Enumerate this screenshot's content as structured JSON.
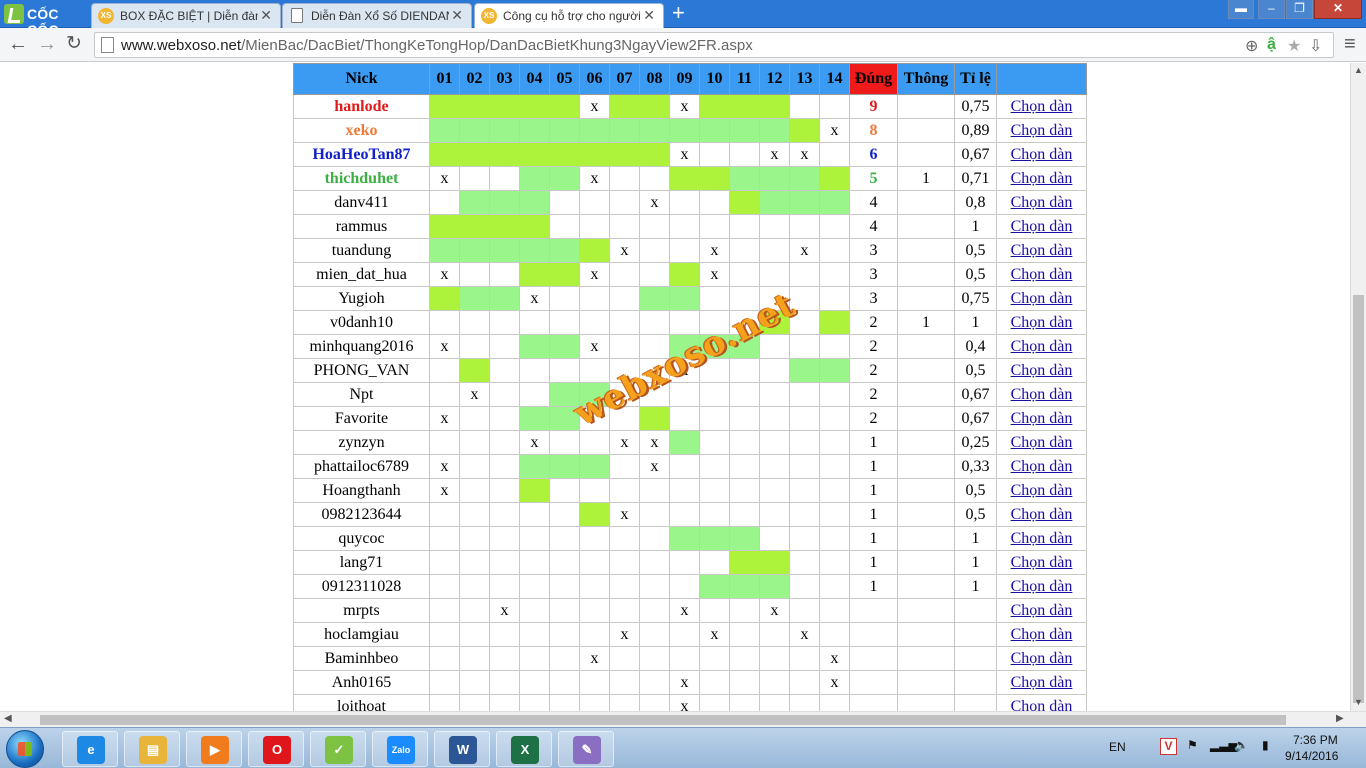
{
  "browser": {
    "brand": "CỐC CỐC",
    "tabs": [
      {
        "title": "BOX ĐẶC BIỆT | Diễn đàn xổ số",
        "icon": "xs-favicon",
        "active": false
      },
      {
        "title": "Diễn Đàn Xổ Số DIENDANXOSO",
        "icon": "page-icon",
        "active": false
      },
      {
        "title": "Công cụ hỗ trợ cho người chơi",
        "icon": "xs-favicon",
        "active": true
      }
    ],
    "favicon_label": "XS",
    "url_domain": "www.webxoso.net",
    "url_path": "/MienBac/DacBiet/ThongKeTongHop/DanDacBietKhung3NgayView2FR.aspx"
  },
  "table": {
    "headers": {
      "nick": "Nick",
      "cols": [
        "01",
        "02",
        "03",
        "04",
        "05",
        "06",
        "07",
        "08",
        "09",
        "10",
        "11",
        "12",
        "13",
        "14"
      ],
      "dung": "Đúng",
      "thong": "Thông",
      "tile": "Tỉ lệ"
    },
    "link_label": "Chọn dàn",
    "rows": [
      {
        "nick": "hanlode",
        "color": "#e01b1b",
        "bold": true,
        "cells": "gggggxggxggg__",
        "dung": "9",
        "thong": "",
        "tile": "0,75"
      },
      {
        "nick": "xeko",
        "color": "#f07a3c",
        "bold": true,
        "cells": "hhhhhhhhhhhhgx",
        "dung": "8",
        "thong": "",
        "tile": "0,89"
      },
      {
        "nick": "HoaHeoTan87",
        "color": "#1020c8",
        "bold": true,
        "cells": "ggggggggx__xx_",
        "dung": "6",
        "thong": "",
        "tile": "0,67"
      },
      {
        "nick": "thichduhet",
        "color": "#3cb043",
        "bold": true,
        "cells": "x__hhx__gghhhg",
        "dung": "5",
        "thong": "1",
        "tile": "0,71"
      },
      {
        "nick": "danv411",
        "color": "#000000",
        "bold": false,
        "cells": "_hhh___x__ghhh",
        "dung": "4",
        "thong": "",
        "tile": "0,8"
      },
      {
        "nick": "rammus",
        "color": "#000000",
        "bold": false,
        "cells": "gggg__________",
        "dung": "4",
        "thong": "",
        "tile": "1"
      },
      {
        "nick": "tuandung",
        "color": "#000000",
        "bold": false,
        "cells": "hhhhhgx__x__x_",
        "dung": "3",
        "thong": "",
        "tile": "0,5"
      },
      {
        "nick": "mien_dat_hua",
        "color": "#000000",
        "bold": false,
        "cells": "x__ggx__gx____",
        "dung": "3",
        "thong": "",
        "tile": "0,5"
      },
      {
        "nick": "Yugioh",
        "color": "#000000",
        "bold": false,
        "cells": "ghhx___hh_____",
        "dung": "3",
        "thong": "",
        "tile": "0,75"
      },
      {
        "nick": "v0danh10",
        "color": "#000000",
        "bold": false,
        "cells": "___________g_g",
        "dung": "2",
        "thong": "1",
        "tile": "1"
      },
      {
        "nick": "minhquang2016",
        "color": "#000000",
        "bold": false,
        "cells": "x__hhx__hhh___",
        "dung": "2",
        "thong": "",
        "tile": "0,4"
      },
      {
        "nick": "PHONG_VAN",
        "color": "#000000",
        "bold": false,
        "cells": "_g______x___hh",
        "dung": "2",
        "thong": "",
        "tile": "0,5"
      },
      {
        "nick": "Npt",
        "color": "#000000",
        "bold": false,
        "cells": "_x__hh________",
        "dung": "2",
        "thong": "",
        "tile": "0,67"
      },
      {
        "nick": "Favorite",
        "color": "#000000",
        "bold": false,
        "cells": "x__hh__g______",
        "dung": "2",
        "thong": "",
        "tile": "0,67"
      },
      {
        "nick": "zynzyn",
        "color": "#000000",
        "bold": false,
        "cells": "___x__xxh_____",
        "dung": "1",
        "thong": "",
        "tile": "0,25"
      },
      {
        "nick": "phattailoc6789",
        "color": "#000000",
        "bold": false,
        "cells": "x__hhh_x______",
        "dung": "1",
        "thong": "",
        "tile": "0,33"
      },
      {
        "nick": "Hoangthanh",
        "color": "#000000",
        "bold": false,
        "cells": "x__g__________",
        "dung": "1",
        "thong": "",
        "tile": "0,5"
      },
      {
        "nick": "0982123644",
        "color": "#000000",
        "bold": false,
        "cells": "_____gx_______",
        "dung": "1",
        "thong": "",
        "tile": "0,5"
      },
      {
        "nick": "quycoc",
        "color": "#000000",
        "bold": false,
        "cells": "________hhh___",
        "dung": "1",
        "thong": "",
        "tile": "1"
      },
      {
        "nick": "lang71",
        "color": "#000000",
        "bold": false,
        "cells": "__________gg__",
        "dung": "1",
        "thong": "",
        "tile": "1"
      },
      {
        "nick": "0912311028",
        "color": "#000000",
        "bold": false,
        "cells": "_________hhh__",
        "dung": "1",
        "thong": "",
        "tile": "1"
      },
      {
        "nick": "mrpts",
        "color": "#000000",
        "bold": false,
        "cells": "__x_____x__x__",
        "dung": "",
        "thong": "",
        "tile": ""
      },
      {
        "nick": "hoclamgiau",
        "color": "#000000",
        "bold": false,
        "cells": "______x__x__x_",
        "dung": "",
        "thong": "",
        "tile": ""
      },
      {
        "nick": "Baminhbeo",
        "color": "#000000",
        "bold": false,
        "cells": "_____x_______x",
        "dung": "",
        "thong": "",
        "tile": ""
      },
      {
        "nick": "Anh0165",
        "color": "#000000",
        "bold": false,
        "cells": "________x____x",
        "dung": "",
        "thong": "",
        "tile": ""
      },
      {
        "nick": "loithoat",
        "color": "#000000",
        "bold": false,
        "cells": "________x_____",
        "dung": "",
        "thong": "",
        "tile": ""
      }
    ]
  },
  "watermark": "webxoso.net",
  "cell_colors": {
    "g": "#adf33c",
    "h": "#9af58a"
  },
  "taskbar": {
    "apps": [
      {
        "name": "ie-icon",
        "glyph": "e",
        "color": "#1e88e5"
      },
      {
        "name": "explorer-icon",
        "glyph": "▤",
        "color": "#e8b43a"
      },
      {
        "name": "media-player-icon",
        "glyph": "▶",
        "color": "#f07c1d"
      },
      {
        "name": "opera-icon",
        "glyph": "O",
        "color": "#e0161d"
      },
      {
        "name": "coccoc-icon",
        "glyph": "✓",
        "color": "#7dc242"
      },
      {
        "name": "zalo-icon",
        "glyph": "Zalo",
        "color": "#1a8cff"
      },
      {
        "name": "word-icon",
        "glyph": "W",
        "color": "#2b5797"
      },
      {
        "name": "excel-icon",
        "glyph": "X",
        "color": "#1e7145"
      },
      {
        "name": "paint-icon",
        "glyph": "✎",
        "color": "#8a6ec2"
      }
    ],
    "lang": "EN",
    "time": "7:36 PM",
    "date": "9/14/2016"
  }
}
